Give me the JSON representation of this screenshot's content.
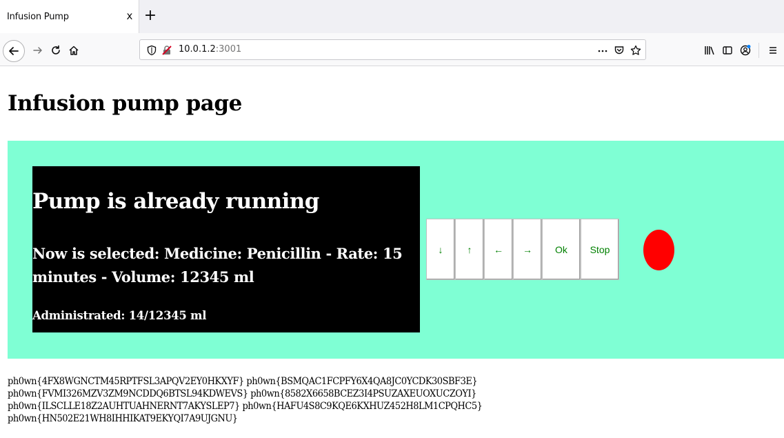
{
  "browser": {
    "tab_title": "Infusion Pump",
    "tab_close": "x",
    "new_tab": "+",
    "url_host": "10.0.1.2",
    "url_port": ":3001",
    "icons": [
      "back-icon",
      "forward-icon",
      "reload-icon",
      "home-icon",
      "shield-icon",
      "insecure-lock-icon",
      "more-icon",
      "pocket-icon",
      "bookmark-star-icon",
      "library-icon",
      "sidebar-icon",
      "account-icon",
      "menu-icon"
    ]
  },
  "page": {
    "title": "Infusion pump page"
  },
  "pump": {
    "status": "Pump is already running",
    "selected": "Now is selected: Medicine: Penicillin - Rate: 15 minutes - Volume: 12345 ml",
    "administrated": "Administrated: 14/12345 ml",
    "buttons": {
      "down": "↓",
      "up": "↑",
      "left": "←",
      "right": "→",
      "ok": "Ok",
      "stop": "Stop"
    },
    "indicator_color": "#ff0000",
    "panel_color": "#7fffd4",
    "button_text_color": "#008000"
  },
  "flags": {
    "line1": "ph0wn{4FX8WGNCTM45RPTFSL3APQV2EY0HKXYF} ph0wn{BSMQAC1FCPFY6X4QA8JC0YCDK30SBF3E}",
    "line2": "ph0wn{FVMI326MZV3ZM9NCDDQ6BTSL94KDWEVS} ph0wn{8582X6658BCEZ3I4PSUZAXEUOXUCZOYI}",
    "line3": "ph0wn{ILSCLLE18Z2AUHTUAHNERNT7AKYSLEP7} ph0wn{HAFU4S8C9KQE6KXHUZ452H8LM1CPQHC5}",
    "line4": "ph0wn{HN502E21WH8IHHIKAT9EKYQI7A9UJGNU}"
  }
}
